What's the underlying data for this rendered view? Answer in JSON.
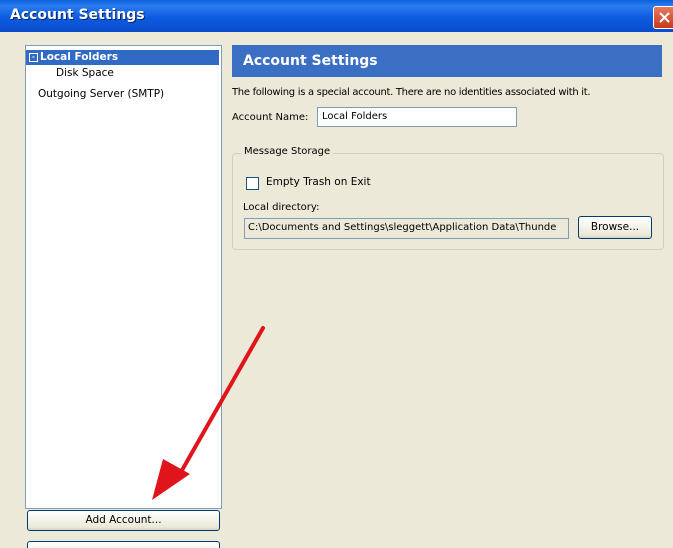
{
  "window": {
    "title": "Account Settings"
  },
  "tree": {
    "items": [
      {
        "label": "Local Folders",
        "expander": "-",
        "selected": true
      },
      {
        "label": "Disk Space"
      },
      {
        "label": "Outgoing Server (SMTP)"
      }
    ]
  },
  "buttons": {
    "add_account": "Add Account..."
  },
  "settings": {
    "heading": "Account Settings",
    "description": "The following is a special account. There are no identities associated with it.",
    "account_name_label": "Account Name:",
    "account_name_value": "Local Folders",
    "message_storage": {
      "legend": "Message Storage",
      "empty_trash_label": "Empty Trash on Exit",
      "empty_trash_checked": false,
      "local_directory_label": "Local directory:",
      "local_directory_value": "C:\\Documents and Settings\\sleggett\\Application Data\\Thunde",
      "browse_label": "Browse..."
    }
  },
  "colors": {
    "titlebar": "#0a5fd8",
    "banner": "#3a6fc4",
    "selection": "#316ac5",
    "arrow": "#e0141b",
    "dialog_bg": "#ece9d8"
  }
}
